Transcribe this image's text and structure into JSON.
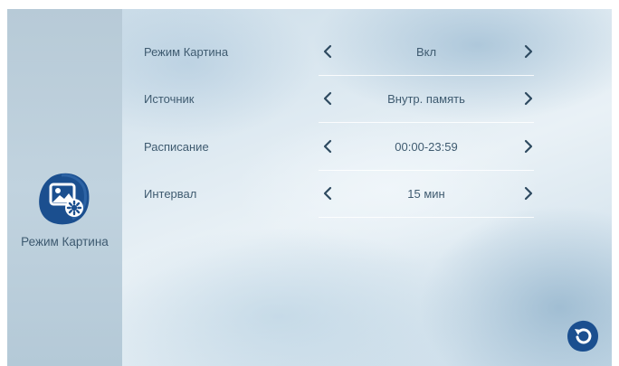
{
  "app": {
    "title": "Режим Картина",
    "icon": "photo-settings-icon"
  },
  "settings": [
    {
      "label": "Режим Картина",
      "value": "Вкл"
    },
    {
      "label": "Источник",
      "value": "Внутр. память"
    },
    {
      "label": "Расписание",
      "value": "00:00-23:59"
    },
    {
      "label": "Интервал",
      "value": "15 мин"
    }
  ],
  "navigation": {
    "back_icon": "back-icon"
  },
  "colors": {
    "accent": "#1b4f8f",
    "text": "#3f5b70",
    "sidebar": "#bccfdc"
  }
}
